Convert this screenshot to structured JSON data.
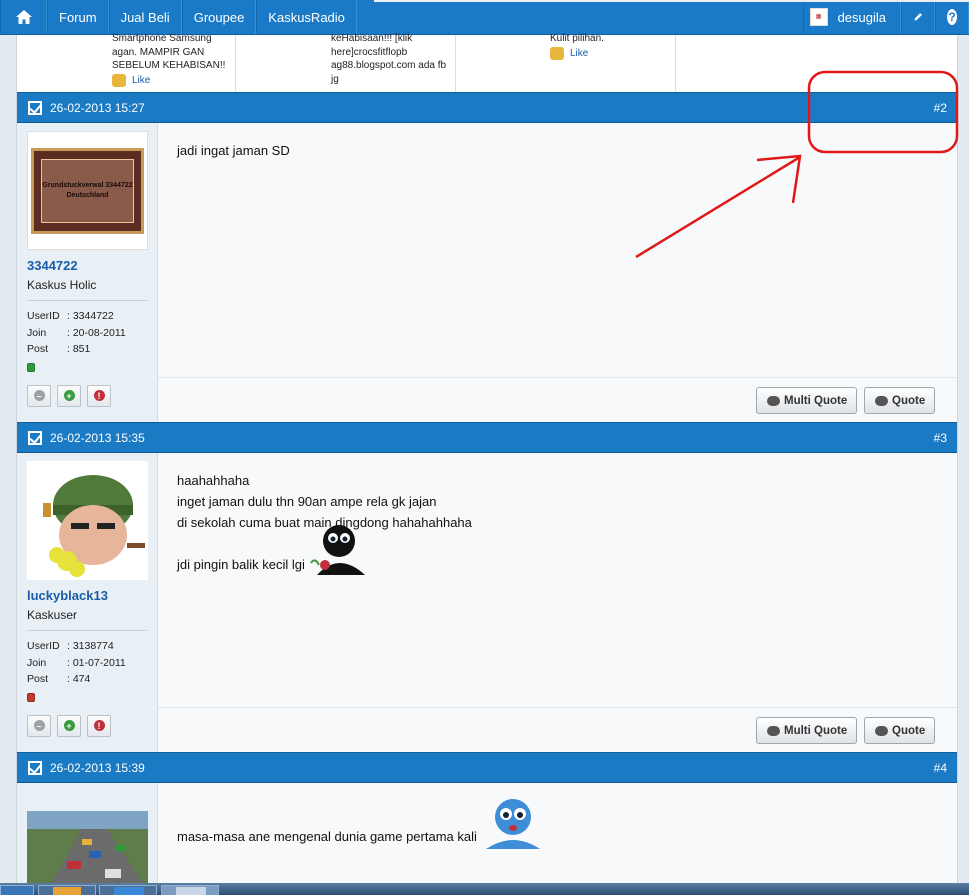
{
  "nav": {
    "home_icon": "home-icon",
    "items": [
      "Forum",
      "Jual Beli",
      "Groupee",
      "KaskusRadio"
    ],
    "username": "desugila",
    "edit_icon": "pencil-icon",
    "help_icon": "?"
  },
  "similar_threads": [
    {
      "text": "Smartphone Samsung agan. MAMPIR GAN SEBELUM KEHABISAN!!",
      "like": "Like"
    },
    {
      "text": "keHabisaan!!! [klik here]crocsfitflopb ag88.blogspot.com ada fb jg"
    },
    {
      "text": "Kulit pilihan.",
      "like": "Like"
    }
  ],
  "posts": [
    {
      "date": "26-02-2013 15:27",
      "number": "#2",
      "avatar_text": "Grundstuckverwal 3344722 Deutschland",
      "username": "3344722",
      "title": "Kaskus Holic",
      "userid_label": "UserID",
      "userid": ": 3344722",
      "join_label": "Join",
      "join": ": 20-08-2011",
      "post_label": "Post",
      "post_count": ": 851",
      "status": "online",
      "lines": [
        "jadi ingat jaman SD"
      ]
    },
    {
      "date": "26-02-2013 15:35",
      "number": "#3",
      "username": "luckyblack13",
      "title": "Kaskuser",
      "userid_label": "UserID",
      "userid": ": 3138774",
      "join_label": "Join",
      "join": ": 01-07-2011",
      "post_label": "Post",
      "post_count": ": 474",
      "status": "offline",
      "lines": [
        "haahahhaha",
        "inget jaman dulu thn 90an ampe rela gk jajan",
        "di sekolah cuma buat main dingdong hahahahhaha",
        "",
        "jdi pingin balik kecil lgi"
      ]
    },
    {
      "date": "26-02-2013 15:39",
      "number": "#4",
      "lines": [
        "masa-masa ane mengenal dunia game pertama kali"
      ]
    }
  ],
  "buttons": {
    "multi_quote": "Multi Quote",
    "quote": "Quote"
  }
}
